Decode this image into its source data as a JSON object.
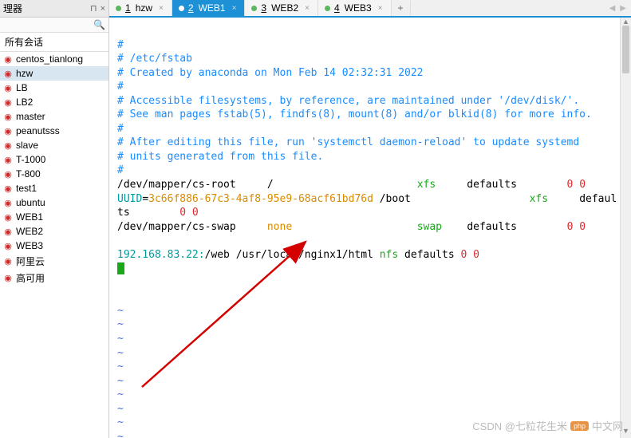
{
  "sidebar": {
    "title": "理器",
    "session_header": "所有会话",
    "items": [
      {
        "label": "centos_tianlong"
      },
      {
        "label": "hzw"
      },
      {
        "label": "LB"
      },
      {
        "label": "LB2"
      },
      {
        "label": "master"
      },
      {
        "label": "peanutsss"
      },
      {
        "label": "slave"
      },
      {
        "label": "T-1000"
      },
      {
        "label": "T-800"
      },
      {
        "label": "test1"
      },
      {
        "label": "ubuntu"
      },
      {
        "label": "WEB1"
      },
      {
        "label": "WEB2"
      },
      {
        "label": "WEB3"
      },
      {
        "label": "阿里云"
      },
      {
        "label": "高可用"
      }
    ],
    "selected_index": 1
  },
  "tabs": {
    "items": [
      {
        "index": "1",
        "label": "hzw"
      },
      {
        "index": "2",
        "label": "WEB1"
      },
      {
        "index": "3",
        "label": "WEB2"
      },
      {
        "index": "4",
        "label": "WEB3"
      }
    ],
    "active_index": 1,
    "add_label": "+"
  },
  "terminal": {
    "l1": "#",
    "l2": "# /etc/fstab",
    "l3": "# Created by anaconda on Mon Feb 14 02:32:31 2022",
    "l4": "#",
    "l5": "# Accessible filesystems, by reference, are maintained under '/dev/disk/'.",
    "l6": "# See man pages fstab(5), findfs(8), mount(8) and/or blkid(8) for more info.",
    "l7": "#",
    "l8": "# After editing this file, run 'systemctl daemon-reload' to update systemd",
    "l9": "# units generated from this file.",
    "l10": "#",
    "root_dev": "/dev/mapper/cs-root     /                       ",
    "root_fs": "xfs",
    "root_opts": "     defaults        ",
    "root_dump": "0 0",
    "uuid_key": "UUID",
    "uuid_eq": "=",
    "uuid_val": "3c66f886-67c3-4af8-95e9-68acf61bd76d",
    "uuid_mnt": " /boot                   ",
    "uuid_fs": "xfs",
    "uuid_opts": "     defaul",
    "uuid_wrap": "ts        ",
    "uuid_dump": "0 0",
    "swap_dev": "/dev/mapper/cs-swap     ",
    "swap_none": "none",
    "swap_pad": "                    ",
    "swap_fs": "swap",
    "swap_opts": "    defaults        ",
    "swap_dump": "0 0",
    "nfs_ip": "192.168.83.22:",
    "nfs_path": "/web /usr/local/nginx1/html ",
    "nfs_fs": "nfs ",
    "nfs_opts": "defaults ",
    "nfs_dump": "0 0",
    "tilde": "~"
  },
  "watermark": {
    "csdn": "CSDN @七粒花生米",
    "badge": "php",
    "cn": "中文网"
  }
}
